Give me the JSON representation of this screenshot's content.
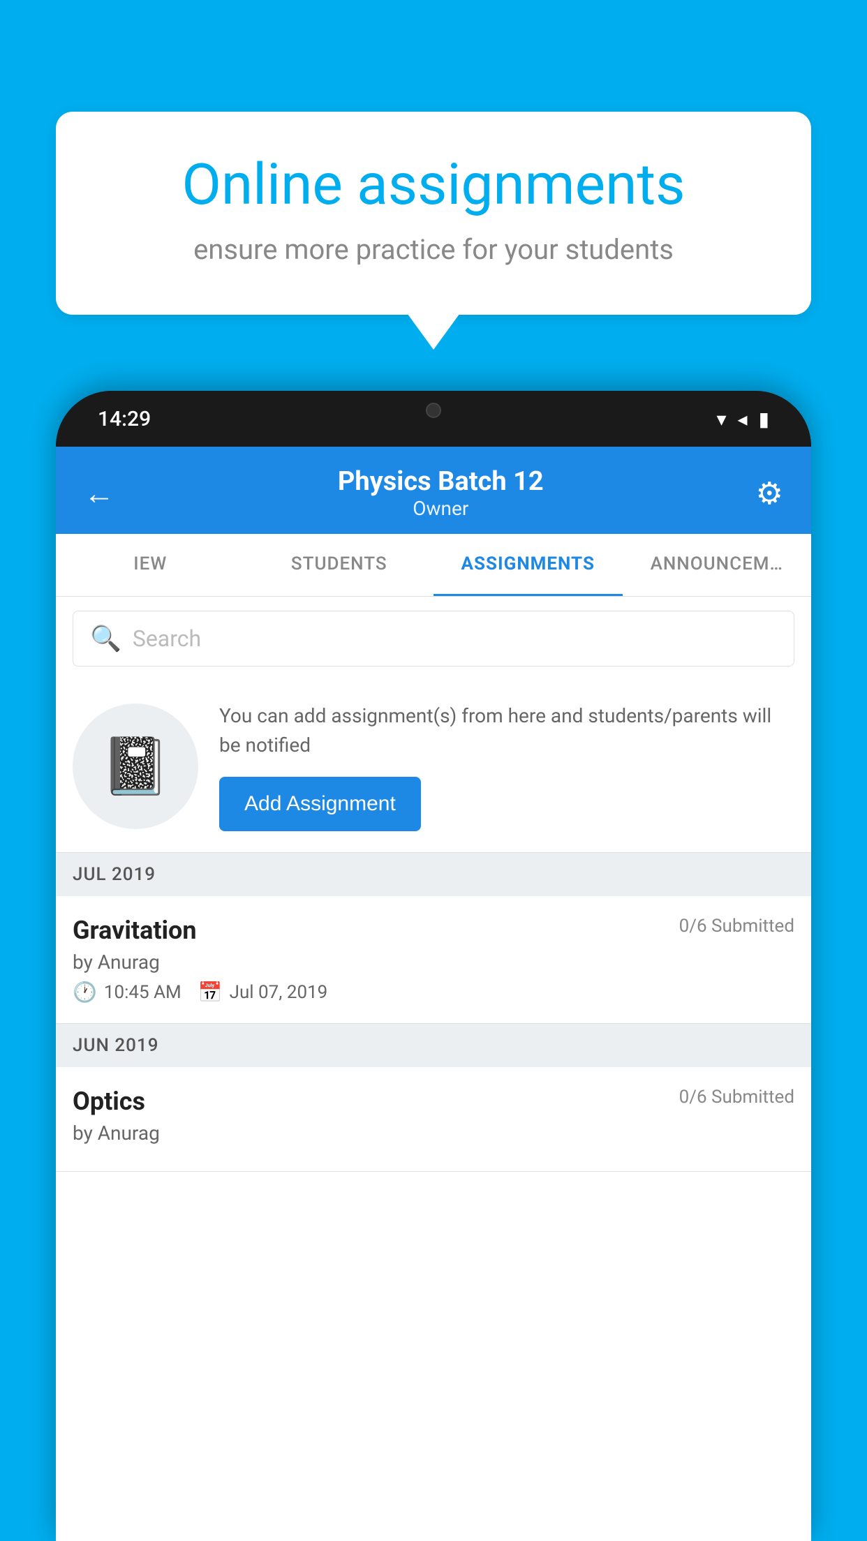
{
  "background": {
    "color": "#00AEEF"
  },
  "speech_bubble": {
    "title": "Online assignments",
    "subtitle": "ensure more practice for your students"
  },
  "status_bar": {
    "time": "14:29",
    "wifi_icon": "▼",
    "signal_icon": "◂",
    "battery_icon": "▮"
  },
  "app_header": {
    "back_label": "←",
    "title": "Physics Batch 12",
    "subtitle": "Owner",
    "settings_icon": "⚙"
  },
  "tabs": [
    {
      "label": "IEW",
      "active": false
    },
    {
      "label": "STUDENTS",
      "active": false
    },
    {
      "label": "ASSIGNMENTS",
      "active": true
    },
    {
      "label": "ANNOUNCEM…",
      "active": false
    }
  ],
  "search": {
    "placeholder": "Search"
  },
  "empty_state": {
    "description": "You can add assignment(s) from here and students/parents will be notified",
    "button_label": "Add Assignment"
  },
  "sections": [
    {
      "label": "JUL 2019",
      "assignments": [
        {
          "name": "Gravitation",
          "submitted": "0/6 Submitted",
          "by": "by Anurag",
          "time": "10:45 AM",
          "date": "Jul 07, 2019"
        }
      ]
    },
    {
      "label": "JUN 2019",
      "assignments": [
        {
          "name": "Optics",
          "submitted": "0/6 Submitted",
          "by": "by Anurag",
          "time": "",
          "date": ""
        }
      ]
    }
  ]
}
